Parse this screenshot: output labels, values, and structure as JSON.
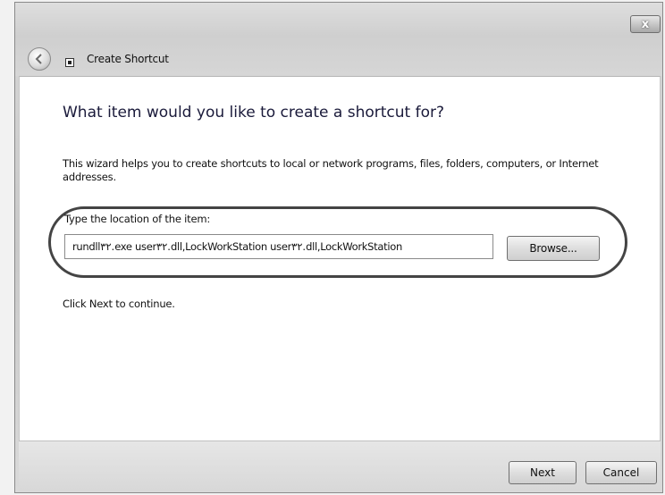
{
  "window": {
    "title": "Create Shortcut",
    "close_label": "x"
  },
  "content": {
    "heading": "What item would you like to create a shortcut for?",
    "description": "This wizard helps you to create shortcuts to local or network programs, files, folders, computers, or Internet addresses.",
    "location_label": "Type the location of the item:",
    "location_value": "rundll۳۲.exe user۳۲.dll,LockWorkStation user۳۲.dll,LockWorkStation",
    "browse_label": "Browse...",
    "next_hint": "Click Next to continue."
  },
  "footer": {
    "next_label": "Next",
    "cancel_label": "Cancel"
  },
  "icons": {
    "back": "back-arrow-icon",
    "shortcut": "shortcut-icon",
    "close": "close-icon"
  }
}
